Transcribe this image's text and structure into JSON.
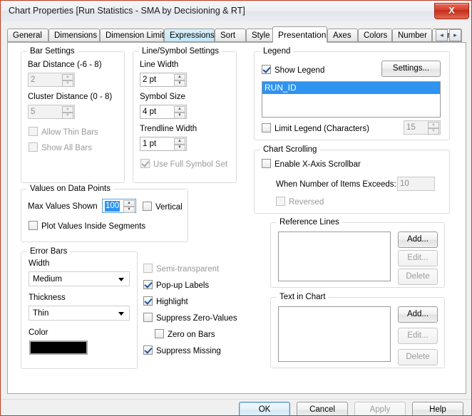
{
  "window": {
    "title": "Chart Properties [Run Statistics - SMA by Decisioning & RT]",
    "close_label": "X",
    "accent_red": "#c23b22",
    "selection_blue": "#2f93f0"
  },
  "tabs": {
    "items": [
      {
        "label": "General",
        "state": "normal"
      },
      {
        "label": "Dimensions",
        "state": "normal"
      },
      {
        "label": "Dimension Limits",
        "state": "normal"
      },
      {
        "label": "Expressions",
        "state": "highlight"
      },
      {
        "label": "Sort",
        "state": "normal"
      },
      {
        "label": "Style",
        "state": "normal"
      },
      {
        "label": "Presentation",
        "state": "selected"
      },
      {
        "label": "Axes",
        "state": "normal"
      },
      {
        "label": "Colors",
        "state": "normal"
      },
      {
        "label": "Number",
        "state": "normal"
      },
      {
        "label": "Font",
        "state": "normal"
      }
    ],
    "nav_prev": "◂",
    "nav_next": "▸"
  },
  "bar_settings": {
    "title": "Bar Settings",
    "bar_distance_label": "Bar Distance (-6 - 8)",
    "bar_distance_value": "2",
    "cluster_distance_label": "Cluster Distance (0 - 8)",
    "cluster_distance_value": "5",
    "allow_thin_bars_label": "Allow Thin Bars",
    "show_all_bars_label": "Show All Bars"
  },
  "line_symbol_settings": {
    "title": "Line/Symbol Settings",
    "line_width_label": "Line Width",
    "line_width_value": "2 pt",
    "symbol_size_label": "Symbol Size",
    "symbol_size_value": "4 pt",
    "trendline_width_label": "Trendline Width",
    "trendline_width_value": "1 pt",
    "use_full_symbol_set_label": "Use Full Symbol Set"
  },
  "values_on_data_points": {
    "title": "Values on Data Points",
    "max_values_shown_label": "Max Values Shown",
    "max_values_shown_value": "100",
    "vertical_label": "Vertical",
    "plot_values_inside_segments_label": "Plot Values Inside Segments"
  },
  "error_bars": {
    "title": "Error Bars",
    "width_label": "Width",
    "width_value": "Medium",
    "thickness_label": "Thickness",
    "thickness_value": "Thin",
    "color_label": "Color",
    "color_value": "#000000"
  },
  "options": {
    "semi_transparent_label": "Semi-transparent",
    "popup_labels_label": "Pop-up Labels",
    "highlight_label": "Highlight",
    "suppress_zero_values_label": "Suppress Zero-Values",
    "zero_on_bars_label": "Zero on Bars",
    "suppress_missing_label": "Suppress Missing"
  },
  "legend": {
    "title": "Legend",
    "show_legend_label": "Show Legend",
    "settings_button": "Settings...",
    "items": [
      "RUN_ID"
    ],
    "limit_legend_label": "Limit Legend (Characters)",
    "limit_legend_value": "15"
  },
  "chart_scrolling": {
    "title": "Chart Scrolling",
    "enable_scrollbar_label": "Enable X-Axis Scrollbar",
    "when_items_exceeds_label": "When Number of Items Exceeds:",
    "when_items_exceeds_value": "10",
    "reversed_label": "Reversed"
  },
  "reference_lines": {
    "title": "Reference Lines",
    "items": [],
    "add_button": "Add...",
    "edit_button": "Edit...",
    "delete_button": "Delete"
  },
  "text_in_chart": {
    "title": "Text in Chart",
    "items": [],
    "add_button": "Add...",
    "edit_button": "Edit...",
    "delete_button": "Delete"
  },
  "footer": {
    "ok": "OK",
    "cancel": "Cancel",
    "apply": "Apply",
    "help": "Help"
  }
}
